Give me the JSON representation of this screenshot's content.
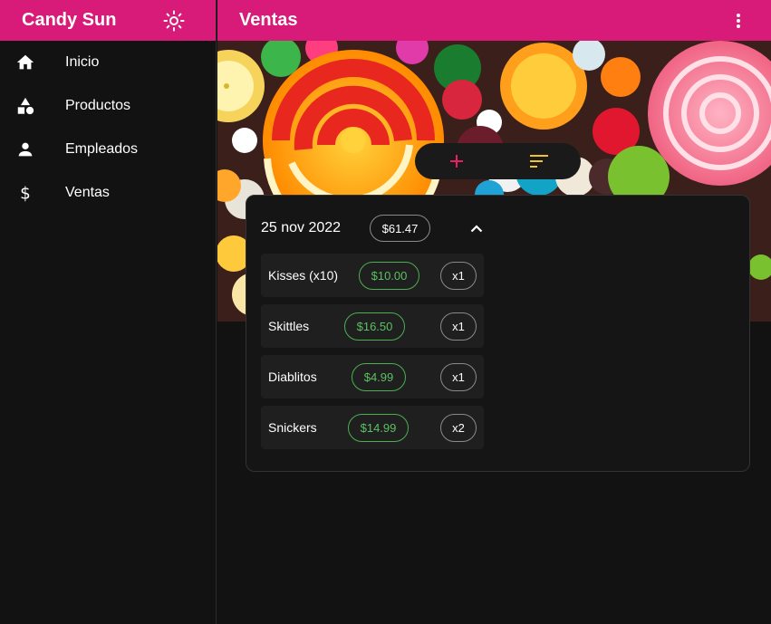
{
  "app": {
    "brand": "Candy Sun",
    "theme_icon": "sun-icon"
  },
  "sidebar": {
    "items": [
      {
        "label": "Inicio",
        "icon": "home-icon"
      },
      {
        "label": "Productos",
        "icon": "category-icon"
      },
      {
        "label": "Empleados",
        "icon": "person-icon"
      },
      {
        "label": "Ventas",
        "icon": "dollar-icon"
      }
    ]
  },
  "header": {
    "title": "Ventas",
    "menu_icon": "more-vert-icon"
  },
  "toolbar": {
    "add_icon": "plus-icon",
    "sort_icon": "sort-icon"
  },
  "sale": {
    "date": "25 nov 2022",
    "total": "$61.47",
    "items": [
      {
        "name": "Kisses (x10)",
        "price": "$10.00",
        "qty": "x1"
      },
      {
        "name": "Skittles",
        "price": "$16.50",
        "qty": "x1"
      },
      {
        "name": "Diablitos",
        "price": "$4.99",
        "qty": "x1"
      },
      {
        "name": "Snickers",
        "price": "$14.99",
        "qty": "x2"
      }
    ]
  },
  "colors": {
    "primary": "#d81b78",
    "accent": "#e91e63",
    "price": "#4caf50",
    "sort": "#f2c12e",
    "background": "#121212"
  }
}
